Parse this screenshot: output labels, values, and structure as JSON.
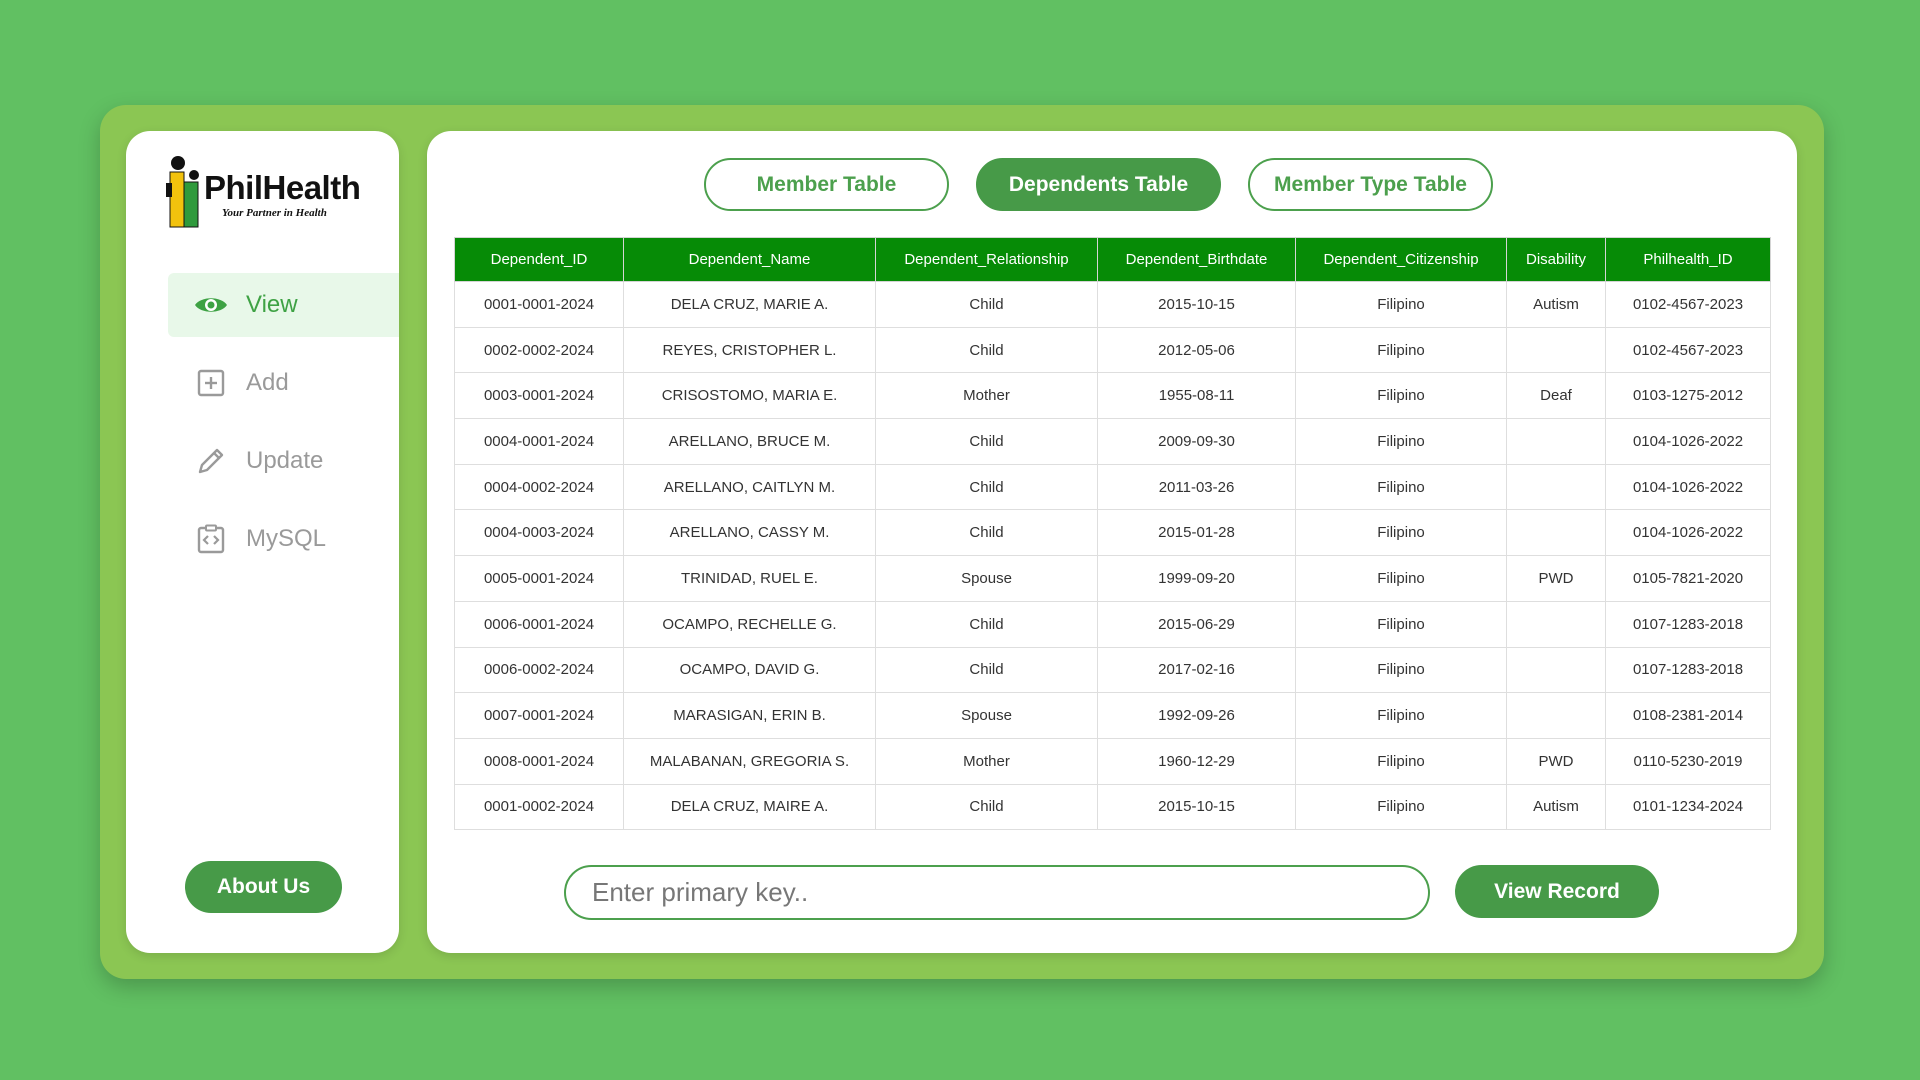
{
  "brand": {
    "name": "PhilHealth",
    "tagline": "Your Partner in Health"
  },
  "sidebar": {
    "items": [
      {
        "label": "View",
        "icon": "eye-icon",
        "active": true
      },
      {
        "label": "Add",
        "icon": "plus-square-icon",
        "active": false
      },
      {
        "label": "Update",
        "icon": "pencil-icon",
        "active": false
      },
      {
        "label": "MySQL",
        "icon": "code-clipboard-icon",
        "active": false
      }
    ],
    "about_label": "About Us"
  },
  "tabs": [
    {
      "label": "Member Table",
      "active": false
    },
    {
      "label": "Dependents Table",
      "active": true
    },
    {
      "label": "Member Type Table",
      "active": false
    }
  ],
  "table": {
    "columns": [
      "Dependent_ID",
      "Dependent_Name",
      "Dependent_Relationship",
      "Dependent_Birthdate",
      "Dependent_Citizenship",
      "Disability",
      "Philhealth_ID"
    ],
    "rows": [
      [
        "0001-0001-2024",
        "DELA CRUZ, MARIE A.",
        "Child",
        "2015-10-15",
        "Filipino",
        "Autism",
        "0102-4567-2023"
      ],
      [
        "0002-0002-2024",
        "REYES, CRISTOPHER L.",
        "Child",
        "2012-05-06",
        "Filipino",
        "",
        "0102-4567-2023"
      ],
      [
        "0003-0001-2024",
        "CRISOSTOMO, MARIA E.",
        "Mother",
        "1955-08-11",
        "Filipino",
        "Deaf",
        "0103-1275-2012"
      ],
      [
        "0004-0001-2024",
        "ARELLANO, BRUCE M.",
        "Child",
        "2009-09-30",
        "Filipino",
        "",
        "0104-1026-2022"
      ],
      [
        "0004-0002-2024",
        "ARELLANO, CAITLYN M.",
        "Child",
        "2011-03-26",
        "Filipino",
        "",
        "0104-1026-2022"
      ],
      [
        "0004-0003-2024",
        "ARELLANO, CASSY M.",
        "Child",
        "2015-01-28",
        "Filipino",
        "",
        "0104-1026-2022"
      ],
      [
        "0005-0001-2024",
        "TRINIDAD, RUEL E.",
        "Spouse",
        "1999-09-20",
        "Filipino",
        "PWD",
        "0105-7821-2020"
      ],
      [
        "0006-0001-2024",
        "OCAMPO, RECHELLE G.",
        "Child",
        "2015-06-29",
        "Filipino",
        "",
        "0107-1283-2018"
      ],
      [
        "0006-0002-2024",
        "OCAMPO, DAVID G.",
        "Child",
        "2017-02-16",
        "Filipino",
        "",
        "0107-1283-2018"
      ],
      [
        "0007-0001-2024",
        "MARASIGAN, ERIN B.",
        "Spouse",
        "1992-09-26",
        "Filipino",
        "",
        "0108-2381-2014"
      ],
      [
        "0008-0001-2024",
        "MALABANAN, GREGORIA S.",
        "Mother",
        "1960-12-29",
        "Filipino",
        "PWD",
        "0110-5230-2019"
      ],
      [
        "0001-0002-2024",
        "DELA CRUZ, MAIRE A.",
        "Child",
        "2015-10-15",
        "Filipino",
        "Autism",
        "0101-1234-2024"
      ]
    ]
  },
  "search": {
    "placeholder": "Enter primary key..",
    "value": ""
  },
  "view_record_label": "View Record",
  "colors": {
    "background": "#61c062",
    "frame": "#8bc653",
    "accent": "#479a48",
    "table_header": "#068b06",
    "active_nav_bg": "#e8f8e9"
  }
}
